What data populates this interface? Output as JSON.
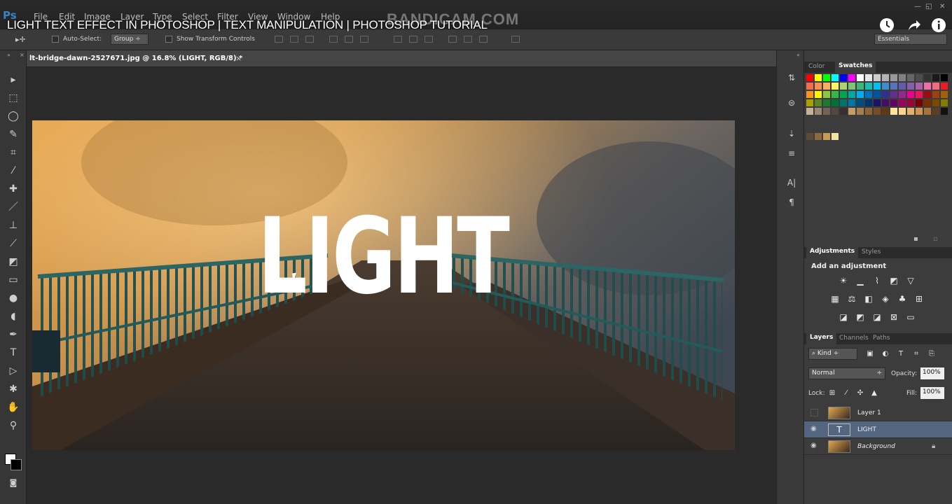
{
  "video": {
    "title": "LIGHT TEXT EFFECT IN PHOTOSHOP | TEXT MANIPULATION | PHOTOSHOP TUTORIAL",
    "watermark": "BANDICAM.COM",
    "buttons": [
      "clock-icon",
      "share-icon",
      "info-icon"
    ]
  },
  "app": {
    "logo": "Ps",
    "menu": [
      "File",
      "Edit",
      "Image",
      "Layer",
      "Type",
      "Select",
      "Filter",
      "View",
      "Window",
      "Help"
    ],
    "window_controls": [
      "—",
      "◱",
      "✕"
    ]
  },
  "options": {
    "auto_select_label": "Auto-Select:",
    "auto_select_value": "Group",
    "show_transform_label": "Show Transform Controls",
    "workspace": "Essentials"
  },
  "document": {
    "tab_label": "lt-bridge-dawn-2527671.jpg @ 16.8% (LIGHT, RGB/8) *",
    "close": "×",
    "headline": "LIGHT"
  },
  "panels": {
    "color_tabs": [
      "Color",
      "Swatches"
    ],
    "adjust_tabs": [
      "Adjustments",
      "Styles"
    ],
    "adjust_title": "Add an adjustment",
    "layer_tabs": [
      "Layers",
      "Channels",
      "Paths"
    ],
    "kind_label": "Kind",
    "blend_mode": "Normal",
    "opacity_label": "Opacity:",
    "opacity_value": "100%",
    "lock_label": "Lock:",
    "fill_label": "Fill:",
    "fill_value": "100%",
    "layers": [
      {
        "name": "Layer 1",
        "visible": false
      },
      {
        "name": "LIGHT",
        "visible": true,
        "type": "text"
      },
      {
        "name": "Background",
        "visible": true,
        "locked": true
      }
    ]
  },
  "colors": {
    "panel_bg": "#3c3c3c",
    "selected_layer": "#53657f",
    "canvas": "#2a2a2a"
  }
}
